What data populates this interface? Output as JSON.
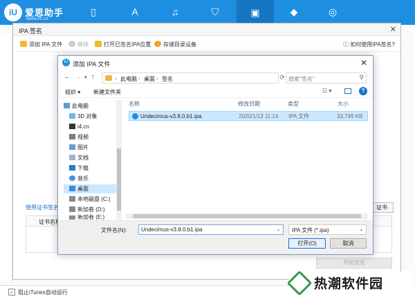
{
  "app": {
    "brand": "爱思助手",
    "brand_sub": "www.i4.cn",
    "nav_icons": [
      "phone-icon",
      "app-store-icon",
      "music-icon",
      "ringtone-icon",
      "toolbox-icon",
      "tutorial-icon",
      "compass-icon"
    ],
    "accent": "#1e8fe0"
  },
  "ipa_window": {
    "title": "IPA 签名",
    "close": "✕",
    "toolbar": {
      "add_ipa": "添加 IPA 文件",
      "remove": "移除",
      "open_folder": "打开已签名IPA位置",
      "storage_device": "存储目录设备",
      "help": "如何使用IPA签名?"
    },
    "cert_link": "使用证书签名",
    "cert_column": "证书名称",
    "right_button": "证书",
    "sign_button": "开始签名"
  },
  "dialog": {
    "title": "添加 IPA 文件",
    "close": "✕",
    "breadcrumb": [
      "此电脑",
      "桌面",
      "签名"
    ],
    "search_placeholder": "搜索\"签名\"",
    "organize": "组织 ▾",
    "new_folder": "新建文件夹",
    "nav_items": [
      {
        "label": "此电脑",
        "icon": "pc-icon"
      },
      {
        "label": "3D 对象",
        "icon": "3d-objects-icon"
      },
      {
        "label": "i4.cn",
        "icon": "folder-icon"
      },
      {
        "label": "视频",
        "icon": "video-icon"
      },
      {
        "label": "图片",
        "icon": "pictures-icon"
      },
      {
        "label": "文档",
        "icon": "documents-icon"
      },
      {
        "label": "下载",
        "icon": "download-icon"
      },
      {
        "label": "音乐",
        "icon": "music-icon"
      },
      {
        "label": "桌面",
        "icon": "desktop-icon",
        "selected": true
      },
      {
        "label": "本地磁盘 (C:)",
        "icon": "drive-icon"
      },
      {
        "label": "新加卷 (D:)",
        "icon": "drive-icon"
      },
      {
        "label": "新加卷 (E:)",
        "icon": "drive-icon"
      }
    ],
    "columns": [
      "名称",
      "修改日期",
      "类型",
      "大小"
    ],
    "files": [
      {
        "name": "Undecimus-v3.8.0.b1.ipa",
        "date": "2020/1/13 11:14",
        "type": "IPA 文件",
        "size": "33,749 KB"
      }
    ],
    "filename_label": "文件名(N):",
    "filename_value": "Undecimus-v3.8.0.b1.ipa",
    "filetype_value": "IPA 文件 (*.ipa)",
    "open_button": "打开(O)",
    "cancel_button": "取消"
  },
  "bottom": {
    "itunes_label": "阻止iTunes自动运行",
    "checked": true
  },
  "watermark": {
    "text": "热潮软件园"
  }
}
